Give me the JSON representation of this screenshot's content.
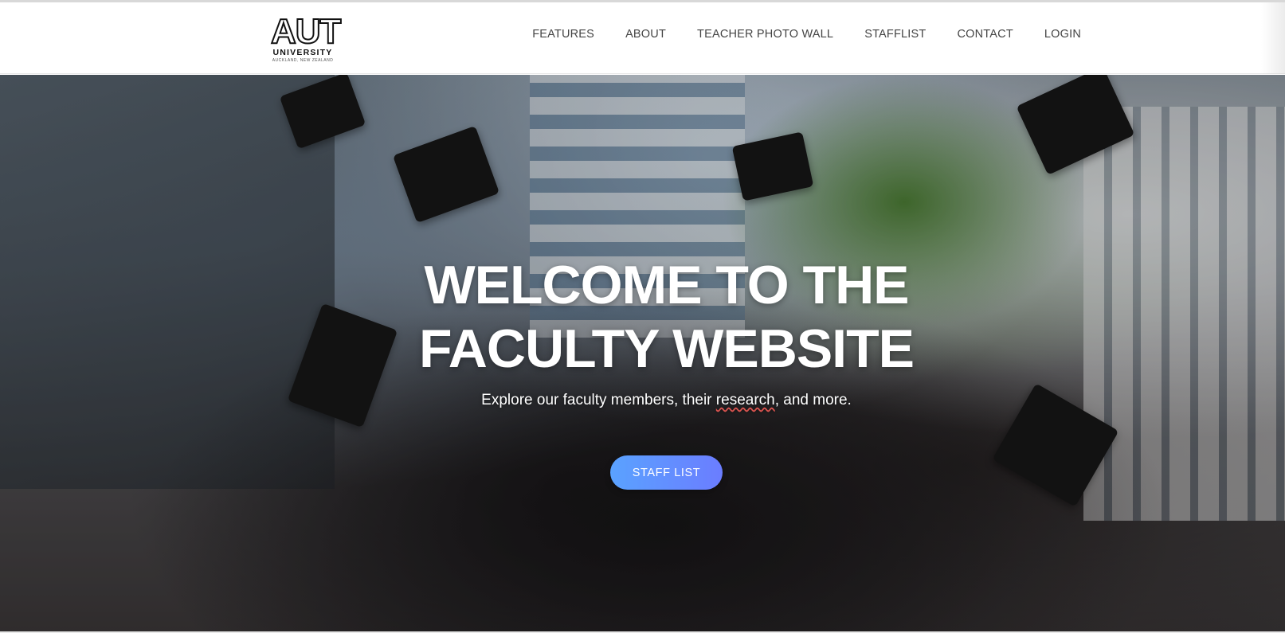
{
  "header": {
    "logo": {
      "word": "AUT",
      "sub": "UNIVERSITY",
      "tagline": "AUCKLAND, NEW ZEALAND"
    },
    "nav": [
      {
        "label": "FEATURES"
      },
      {
        "label": "ABOUT"
      },
      {
        "label": "TEACHER PHOTO WALL"
      },
      {
        "label": "STAFFLIST"
      },
      {
        "label": "CONTACT"
      },
      {
        "label": "LOGIN"
      }
    ]
  },
  "hero": {
    "title_line1": "WELCOME TO THE",
    "title_line2": "FACULTY WEBSITE",
    "subtitle_before": "Explore our faculty members, their ",
    "subtitle_spell": "research",
    "subtitle_after": ", and more.",
    "cta_label": "STAFF LIST",
    "cta_color_start": "#5aa2ff",
    "cta_color_end": "#6b7dff"
  }
}
